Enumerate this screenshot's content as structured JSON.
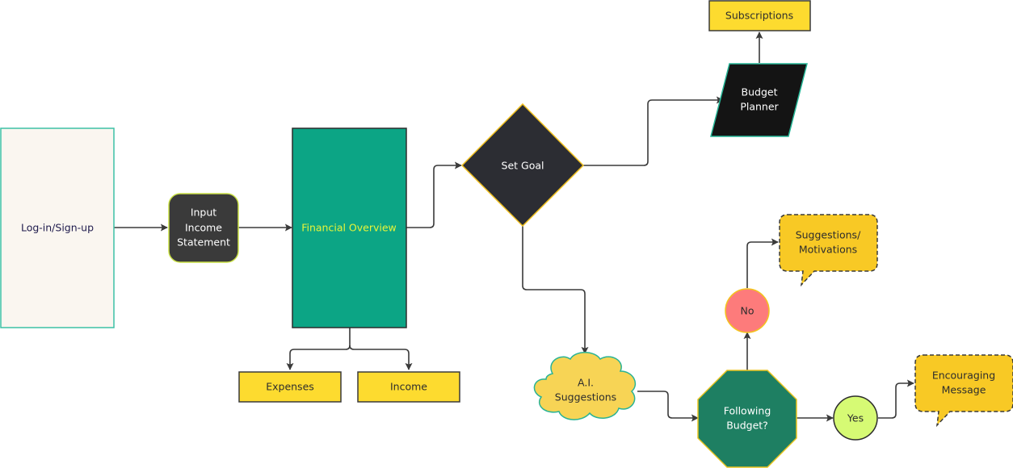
{
  "diagram": {
    "type": "flowchart",
    "nodes": {
      "login": {
        "label": [
          "Log-in/Sign-up"
        ],
        "shape": "rectangle",
        "fill": "#faf6f0",
        "stroke": "#3cc1a6",
        "text": "#1f1b4d"
      },
      "input_income": {
        "label": [
          "Input",
          "Income",
          "Statement"
        ],
        "shape": "rounded-rectangle",
        "fill": "#3a3a3a",
        "stroke": "#c9e045",
        "text": "#ffffff"
      },
      "financial_overview": {
        "label": [
          "Financial Overview"
        ],
        "shape": "rectangle",
        "fill": "#0ca585",
        "stroke": "#2d2d2d",
        "text": "#e7f53a"
      },
      "expenses": {
        "label": [
          "Expenses"
        ],
        "shape": "rectangle",
        "fill": "#fddb2f",
        "stroke": "#3a3a3a",
        "text": "#2d2d2d"
      },
      "income": {
        "label": [
          "Income"
        ],
        "shape": "rectangle",
        "fill": "#fddb2f",
        "stroke": "#3a3a3a",
        "text": "#2d2d2d"
      },
      "set_goal": {
        "label": [
          "Set Goal"
        ],
        "shape": "diamond",
        "fill": "#2c2d33",
        "stroke": "#f0c020",
        "text": "#ffffff"
      },
      "budget_planner": {
        "label": [
          "Budget",
          "Planner"
        ],
        "shape": "parallelogram",
        "fill": "#141414",
        "stroke": "#25b596",
        "text": "#ffffff"
      },
      "subscriptions": {
        "label": [
          "Subscriptions"
        ],
        "shape": "rectangle",
        "fill": "#fddb2f",
        "stroke": "#3a3a3a",
        "text": "#2d2d2d"
      },
      "ai_suggestions": {
        "label": [
          "A.I.",
          "Suggestions"
        ],
        "shape": "cloud",
        "fill": "#f7d455",
        "stroke": "#2ab395",
        "text": "#2d2d2d"
      },
      "following_budget": {
        "label": [
          "Following",
          "Budget?"
        ],
        "shape": "octagon",
        "fill": "#1e7f62",
        "stroke": "#e8c41e",
        "text": "#ffffff"
      },
      "no": {
        "label": [
          "No"
        ],
        "shape": "circle",
        "fill": "#fd7b7b",
        "stroke": "#f3c41c",
        "text": "#2d2d2d"
      },
      "yes": {
        "label": [
          "Yes"
        ],
        "shape": "circle",
        "fill": "#d6fa74",
        "stroke": "#2d2d2d",
        "text": "#2d2d2d"
      },
      "suggestions_motivations": {
        "label": [
          "Suggestions/",
          "Motivations"
        ],
        "shape": "speech-bubble",
        "fill": "#f8c925",
        "stroke": "#3a3a3a",
        "text": "#2d2d2d"
      },
      "encouraging_message": {
        "label": [
          "Encouraging",
          "Message"
        ],
        "shape": "speech-bubble",
        "fill": "#f8c925",
        "stroke": "#3a3a3a",
        "text": "#2d2d2d"
      }
    },
    "edges": [
      {
        "from": "login",
        "to": "input_income"
      },
      {
        "from": "input_income",
        "to": "financial_overview"
      },
      {
        "from": "financial_overview",
        "to": "expenses"
      },
      {
        "from": "financial_overview",
        "to": "income"
      },
      {
        "from": "financial_overview",
        "to": "set_goal"
      },
      {
        "from": "set_goal",
        "to": "budget_planner"
      },
      {
        "from": "budget_planner",
        "to": "subscriptions"
      },
      {
        "from": "set_goal",
        "to": "ai_suggestions"
      },
      {
        "from": "ai_suggestions",
        "to": "following_budget"
      },
      {
        "from": "following_budget",
        "to": "no"
      },
      {
        "from": "following_budget",
        "to": "yes"
      },
      {
        "from": "no",
        "to": "suggestions_motivations"
      },
      {
        "from": "yes",
        "to": "encouraging_message"
      }
    ],
    "edge_color": "#3a3a3a"
  }
}
